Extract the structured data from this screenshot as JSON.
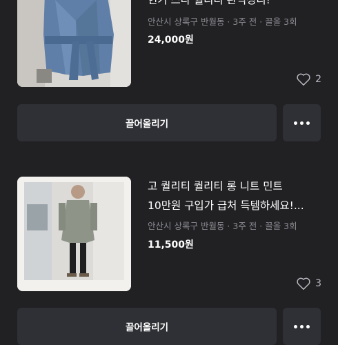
{
  "listings": [
    {
      "title": "현기 스타 퀄리티 완벽정리!",
      "meta": "안산시 상록구 반월동 · 3주 전 · 끌올 3회",
      "price": "24,000원",
      "likes": "2",
      "thumb_icon": "denim-jacket-photo"
    },
    {
      "title_line1": "고 퀄리티 퀄리티 롱 니트 민트",
      "title_line2": "10만원 구입가 급처 득템하세요!...",
      "meta": "안산시 상록구 반월동 · 3주 전 · 끌올 3회",
      "price": "11,500원",
      "likes": "3",
      "thumb_icon": "long-knit-photo"
    }
  ],
  "actions": {
    "bump_label": "끌어올리기",
    "more_icon": "more-horizontal-icon"
  },
  "colors": {
    "background": "#212124",
    "button_bg": "#2f3035",
    "meta_text": "#8a8b90",
    "title_text": "#ffffff"
  }
}
